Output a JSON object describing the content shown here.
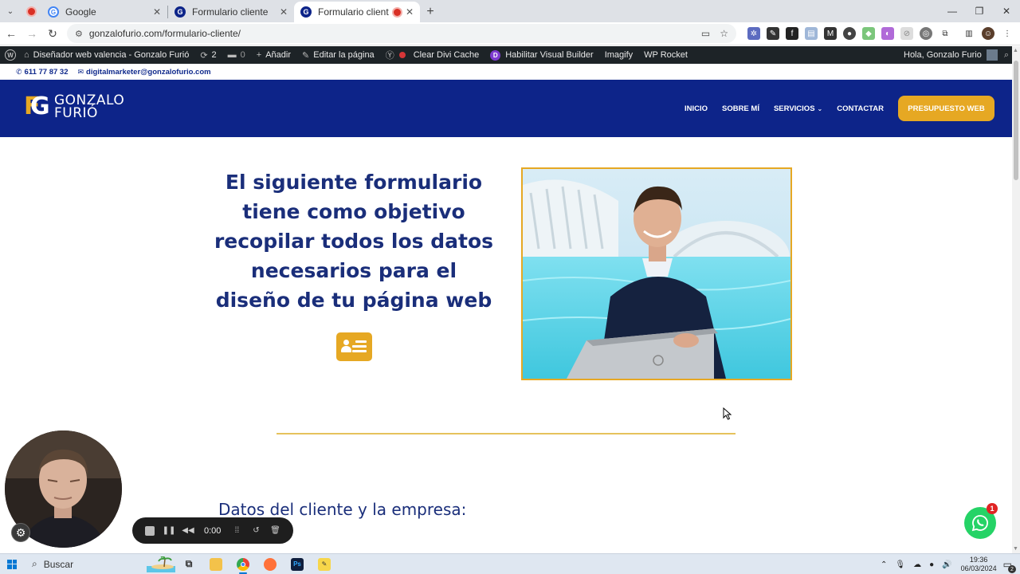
{
  "browser": {
    "tabs": [
      {
        "title": "Google",
        "favicon": "google-icon",
        "active": false
      },
      {
        "title": "Formulario cliente",
        "favicon": "gonzalo-icon",
        "active": false
      },
      {
        "title": "Formulario cliente",
        "favicon": "gonzalo-icon",
        "active": true,
        "recording": true
      }
    ],
    "url": "gonzalofurio.com/formulario-cliente/"
  },
  "wp_admin_bar": {
    "site_name": "Diseñador web valencia - Gonzalo Furió",
    "updates_count": "2",
    "comments_count": "0",
    "add_label": "Añadir",
    "edit_label": "Editar la página",
    "clear_cache_label": "Clear Divi Cache",
    "visual_builder_label": "Habilitar Visual Builder",
    "imagify_label": "Imagify",
    "wp_rocket_label": "WP Rocket",
    "greeting": "Hola, Gonzalo Furio"
  },
  "site": {
    "phone": "611 77 87 32",
    "email": "digitalmarketer@gonzalofurio.com",
    "logo_line1": "GONZALO",
    "logo_line2": "FURIÓ",
    "nav": {
      "inicio": "INICIO",
      "sobre_mi": "SOBRE MÍ",
      "servicios": "SERVICIOS",
      "contactar": "CONTACTAR",
      "cta": "PRESUPUESTO WEB"
    },
    "hero_title": "El siguiente formulario tiene como objetivo recopilar todos los datos necesarios para el diseño de tu página web",
    "section_title": "Datos del cliente y la empresa:",
    "colors": {
      "brand_blue": "#0d2489",
      "accent_gold": "#e6a823",
      "title_blue": "#1a2e7a"
    }
  },
  "recorder": {
    "time": "0:00"
  },
  "whatsapp": {
    "badge": "1"
  },
  "taskbar": {
    "search_placeholder": "Buscar",
    "time": "19:36",
    "date": "06/03/2024",
    "notifications": "2"
  }
}
